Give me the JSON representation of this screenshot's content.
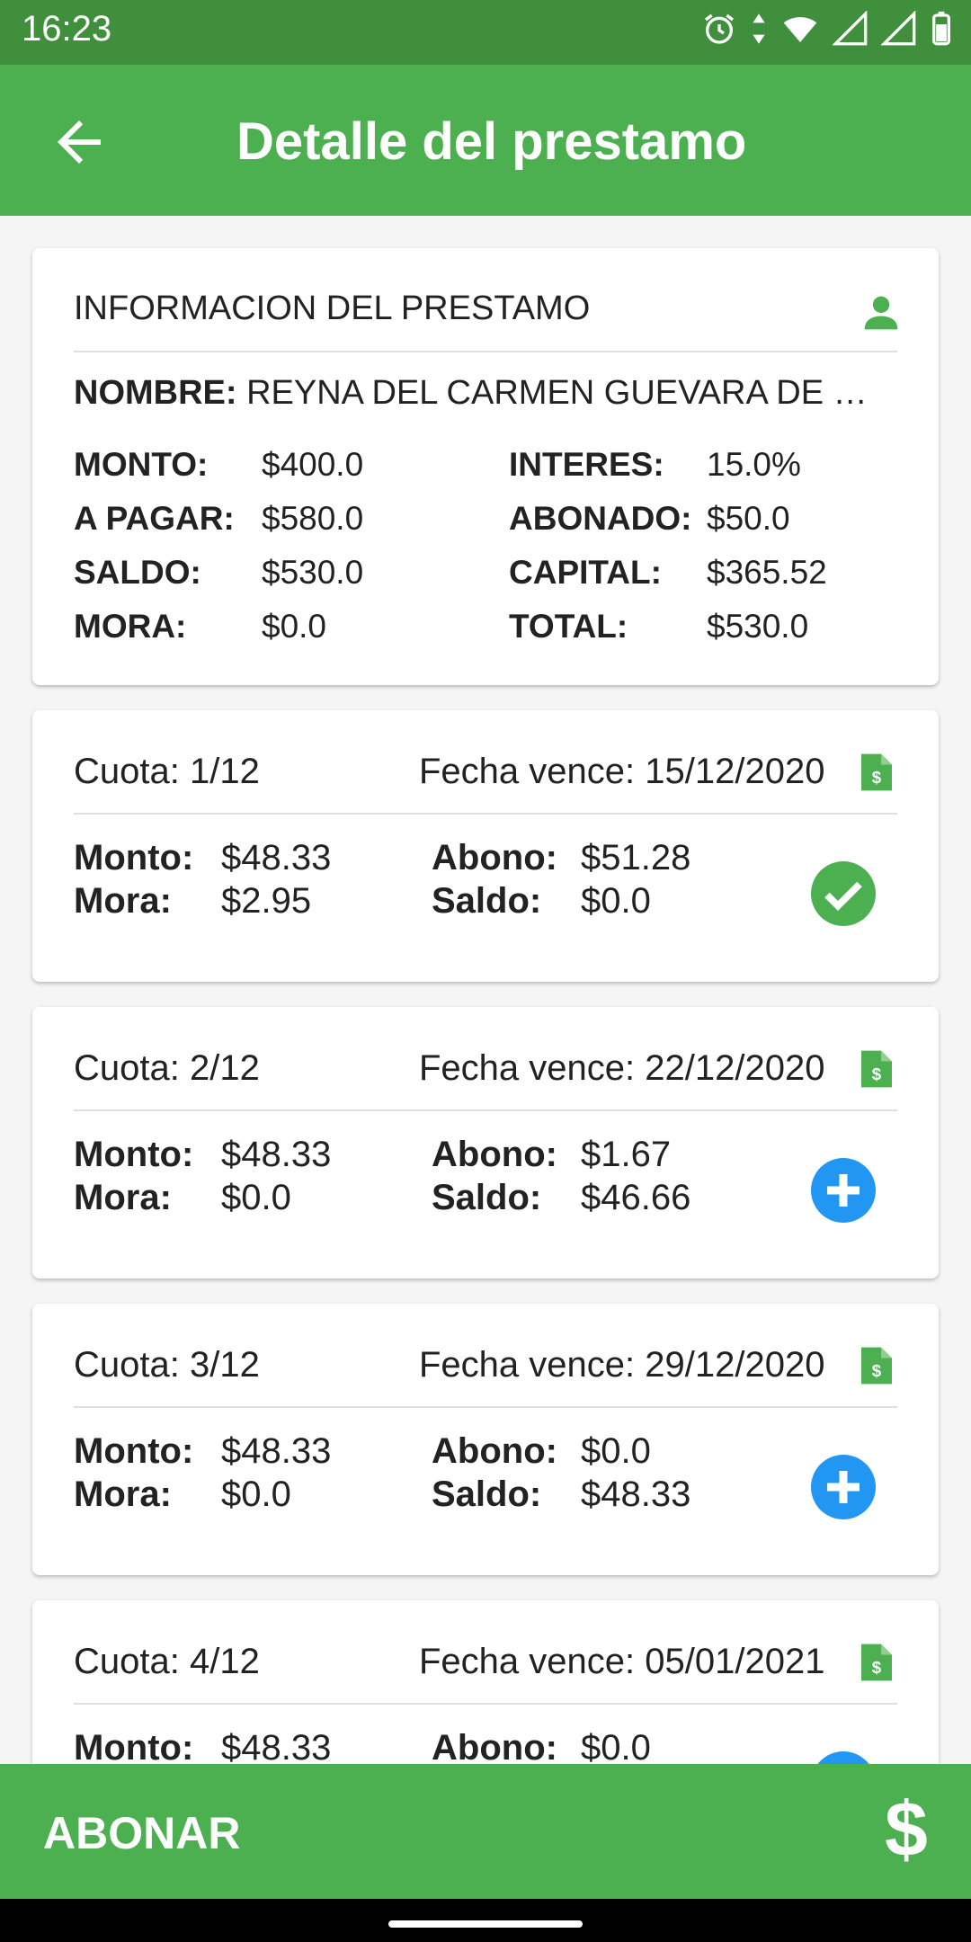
{
  "status": {
    "time": "16:23"
  },
  "appbar": {
    "title": "Detalle del prestamo"
  },
  "info": {
    "title": "INFORMACION DEL PRESTAMO",
    "name_label": "NOMBRE:",
    "name_value": "REYNA DEL CARMEN GUEVARA DE …",
    "rows": [
      {
        "l1": "MONTO:",
        "v1": "$400.0",
        "l2": "INTERES:",
        "v2": "15.0%"
      },
      {
        "l1": "A PAGAR:",
        "v1": "$580.0",
        "l2": "ABONADO:",
        "v2": "$50.0"
      },
      {
        "l1": "SALDO:",
        "v1": "$530.0",
        "l2": "CAPITAL:",
        "v2": "$365.52"
      },
      {
        "l1": "MORA:",
        "v1": "$0.0",
        "l2": "TOTAL:",
        "v2": "$530.0"
      }
    ]
  },
  "cuotas": [
    {
      "cuota": "Cuota: 1/12",
      "fecha": "Fecha vence: 15/12/2020",
      "monto_label": "Monto:",
      "monto": "$48.33",
      "mora_label": "Mora:",
      "mora": "$2.95",
      "abono_label": "Abono:",
      "abono": "$51.28",
      "saldo_label": "Saldo:",
      "saldo": "$0.0",
      "status_icon": "check-circle-icon",
      "status_color": "#4caf50"
    },
    {
      "cuota": "Cuota: 2/12",
      "fecha": "Fecha vence: 22/12/2020",
      "monto_label": "Monto:",
      "monto": "$48.33",
      "mora_label": "Mora:",
      "mora": "$0.0",
      "abono_label": "Abono:",
      "abono": "$1.67",
      "saldo_label": "Saldo:",
      "saldo": "$46.66",
      "status_icon": "add-circle-icon",
      "status_color": "#2196f3"
    },
    {
      "cuota": "Cuota: 3/12",
      "fecha": "Fecha vence: 29/12/2020",
      "monto_label": "Monto:",
      "monto": "$48.33",
      "mora_label": "Mora:",
      "mora": "$0.0",
      "abono_label": "Abono:",
      "abono": "$0.0",
      "saldo_label": "Saldo:",
      "saldo": "$48.33",
      "status_icon": "add-circle-icon",
      "status_color": "#2196f3"
    },
    {
      "cuota": "Cuota: 4/12",
      "fecha": "Fecha vence: 05/01/2021",
      "monto_label": "Monto:",
      "monto": "$48.33",
      "abono_label": "Abono:",
      "abono": "$0.0",
      "status_icon": "add-circle-icon",
      "status_color": "#2196f3"
    }
  ],
  "footer": {
    "label": "ABONAR",
    "icon_text": "$"
  },
  "colors": {
    "primary": "#4caf50",
    "status_bar": "#3f8f3c",
    "accent_blue": "#2196f3"
  }
}
